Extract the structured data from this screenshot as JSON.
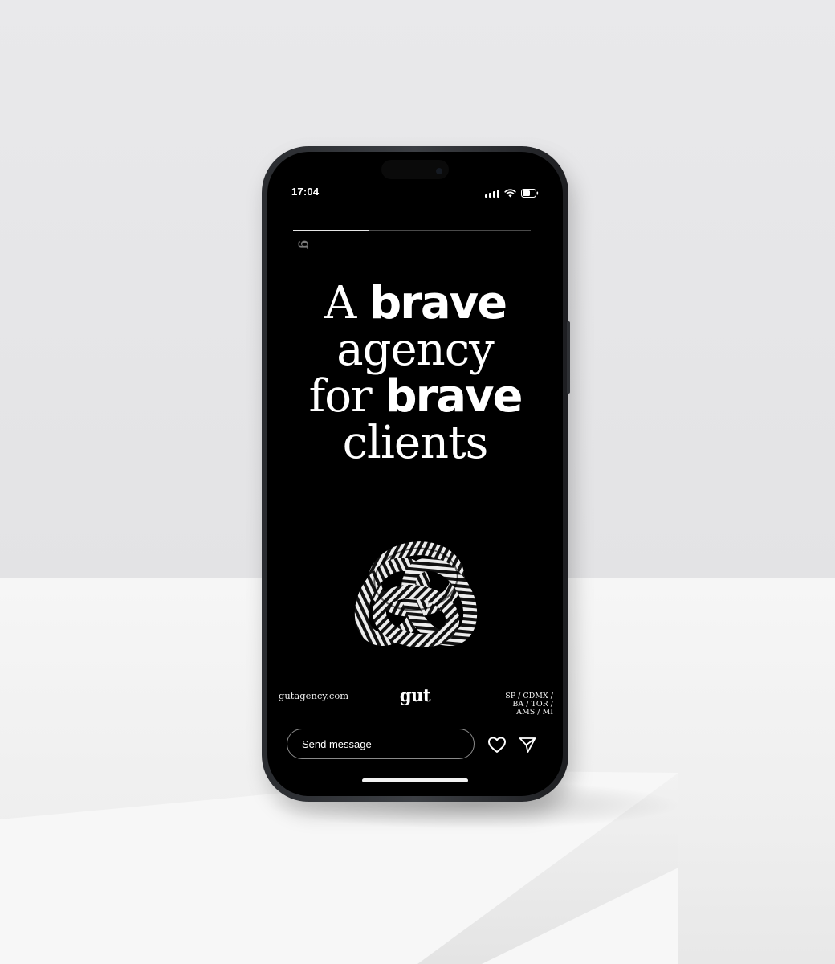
{
  "status_bar": {
    "time": "17:04",
    "icons": [
      "signal-icon",
      "wifi-icon",
      "battery-icon"
    ]
  },
  "story": {
    "progress": 0.32,
    "headline": {
      "line1_regular": "A",
      "line1_bold": "brave",
      "line2_regular": "agency",
      "line3_regular": "for",
      "line3_bold": "brave",
      "line4_regular": "clients"
    },
    "footer": {
      "website": "gutagency.com",
      "logo": "gut",
      "cities_line1": "SP / CDMX /",
      "cities_line2": "BA / TOR /",
      "cities_line3": "AMS / MI"
    }
  },
  "reply_bar": {
    "placeholder": "Send message",
    "like_icon": "heart-icon",
    "share_icon": "send-icon"
  },
  "colors": {
    "screen_bg": "#000000",
    "text": "#ffffff",
    "wall": "#e6e6e8",
    "frame": "#2a2c30"
  }
}
